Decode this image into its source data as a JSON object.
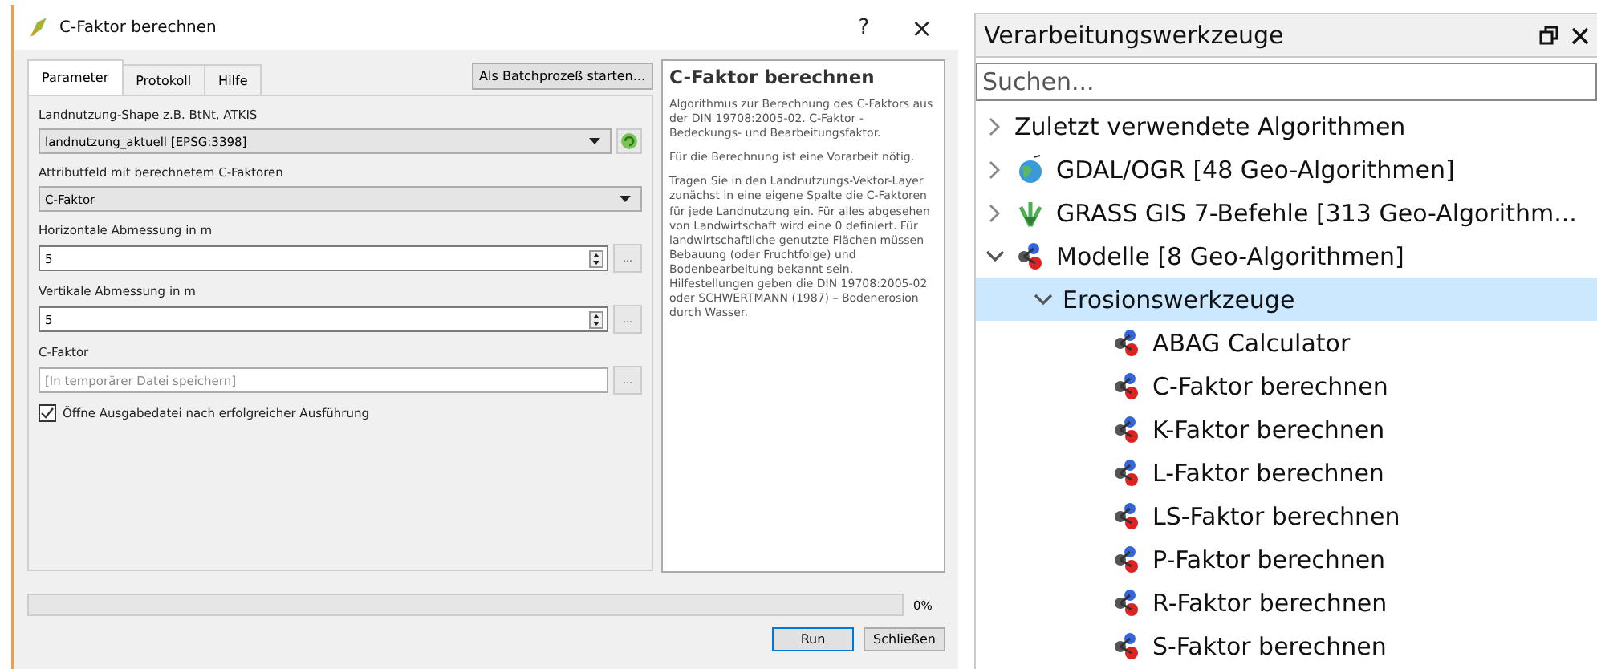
{
  "dialog": {
    "title": "C-Faktor berechnen",
    "help_button": "?",
    "close_button": "×",
    "tabs": [
      {
        "label": "Parameter",
        "selected": true
      },
      {
        "label": "Protokoll",
        "selected": false
      },
      {
        "label": "Hilfe",
        "selected": false
      }
    ],
    "batch_button": "Als Batchprozeß starten...",
    "parameters": [
      {
        "kind": "layer",
        "label": "Landnutzung-Shape z.B. BtNt, ATKIS",
        "value": "landnutzung_aktuell [EPSG:3398]"
      },
      {
        "kind": "select",
        "label": "Attributfeld mit berechnetem C-Faktoren",
        "value": "C-Faktor"
      },
      {
        "kind": "number",
        "label": "Horizontale Abmessung in m",
        "value": "5",
        "more": "..."
      },
      {
        "kind": "number",
        "label": "Vertikale Abmessung in m",
        "value": "5",
        "more": "..."
      },
      {
        "kind": "output",
        "label": "C-Faktor",
        "placeholder": "[In temporärer Datei speichern]",
        "more": "..."
      },
      {
        "kind": "checkbox",
        "label": "Öffne Ausgabedatei nach erfolgreicher Ausführung",
        "checked": true
      }
    ],
    "help": {
      "title": "C-Faktor berechnen",
      "paragraphs": [
        "Algorithmus zur Berechnung des C-Faktors aus der DIN 19708:2005-02. C-Faktor - Bedeckungs- und Bearbeitungsfaktor.",
        "Für die Berechnung ist eine Vorarbeit nötig.",
        "Tragen Sie in den Landnutzungs-Vektor-Layer zunächst in eine eigene Spalte die C-Faktoren für jede Landnutzung ein. Für alles abgesehen von Landwirtschaft wird eine 0 definiert. Für landwirtschaftliche genutzte Flächen müssen Bebauung (oder Fruchtfolge) und Bodenbearbeitung bekannt sein. Hilfestellungen geben die DIN 19708:2005-02 oder SCHWERTMANN (1987) – Bodenerosion durch Wasser."
      ]
    },
    "progress": {
      "level": 0,
      "reading": "0%"
    },
    "buttons": [
      {
        "label": "Run",
        "default": true
      },
      {
        "label": "Schließen",
        "default": false
      }
    ]
  },
  "toolbox": {
    "title": "Verarbeitungswerkzeuge",
    "search": {
      "placeholder": "Suchen..."
    },
    "tree": [
      {
        "label": "Zuletzt verwendete Algorithmen",
        "expanded": false,
        "selected": false
      },
      {
        "label": "GDAL/OGR [48 Geo-Algorithmen]",
        "kind": "globe",
        "expanded": false,
        "selected": false
      },
      {
        "label": "GRASS GIS 7-Befehle [313 Geo-Algorithm...",
        "kind": "plant",
        "expanded": false,
        "selected": false
      },
      {
        "label": "Modelle [8 Geo-Algorithmen]",
        "kind": "model",
        "expanded": true,
        "selected": false,
        "children": [
          {
            "label": "Erosionswerkzeuge",
            "expanded": true,
            "selected": true,
            "children": [
              {
                "label": "ABAG Calculator",
                "kind": "model",
                "selected": false
              },
              {
                "label": "C-Faktor berechnen",
                "kind": "model",
                "selected": false
              },
              {
                "label": "K-Faktor berechnen",
                "kind": "model",
                "selected": false
              },
              {
                "label": "L-Faktor berechnen",
                "kind": "model",
                "selected": false
              },
              {
                "label": "LS-Faktor berechnen",
                "kind": "model",
                "selected": false
              },
              {
                "label": "P-Faktor berechnen",
                "kind": "model",
                "selected": false
              },
              {
                "label": "R-Faktor berechnen",
                "kind": "model",
                "selected": false
              },
              {
                "label": "S-Faktor berechnen",
                "kind": "model",
                "selected": false
              }
            ]
          }
        ]
      }
    ]
  }
}
